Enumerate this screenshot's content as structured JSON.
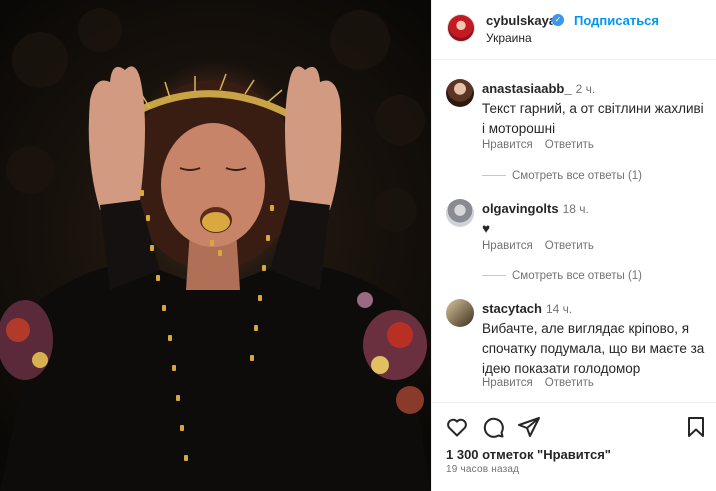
{
  "post": {
    "username": "cybulskaya",
    "follow_label": "Подписаться",
    "location": "Украина",
    "likes_text": "1 300 отметок \"Нравится\"",
    "posted_ago": "19 часов назад"
  },
  "comments": [
    {
      "username": "anastasiaabb_",
      "time": "2 ч.",
      "text": "Текст гарний, а от світлини жахливі і моторошні",
      "like_label": "Нравится",
      "reply_label": "Ответить",
      "see_replies": "Смотреть все ответы (1)"
    },
    {
      "username": "olgavingolts",
      "time": "18 ч.",
      "text": "♥",
      "like_label": "Нравится",
      "reply_label": "Ответить",
      "see_replies": "Смотреть все ответы (1)"
    },
    {
      "username": "stacytach",
      "time": "14 ч.",
      "text": "Вибачте, але виглядає кріпово, я спочатку подумала, що ви маєте за ідею показати голодомор",
      "like_label": "Нравится",
      "reply_label": "Ответить"
    }
  ],
  "icons": {
    "like": "heart-icon",
    "comment": "comment-icon",
    "share": "paper-plane-icon",
    "save": "bookmark-icon",
    "verified": "verified-badge-icon"
  },
  "colors": {
    "follow": "#0095f6",
    "verified": "#3897f0",
    "secondary_text": "#737373"
  }
}
